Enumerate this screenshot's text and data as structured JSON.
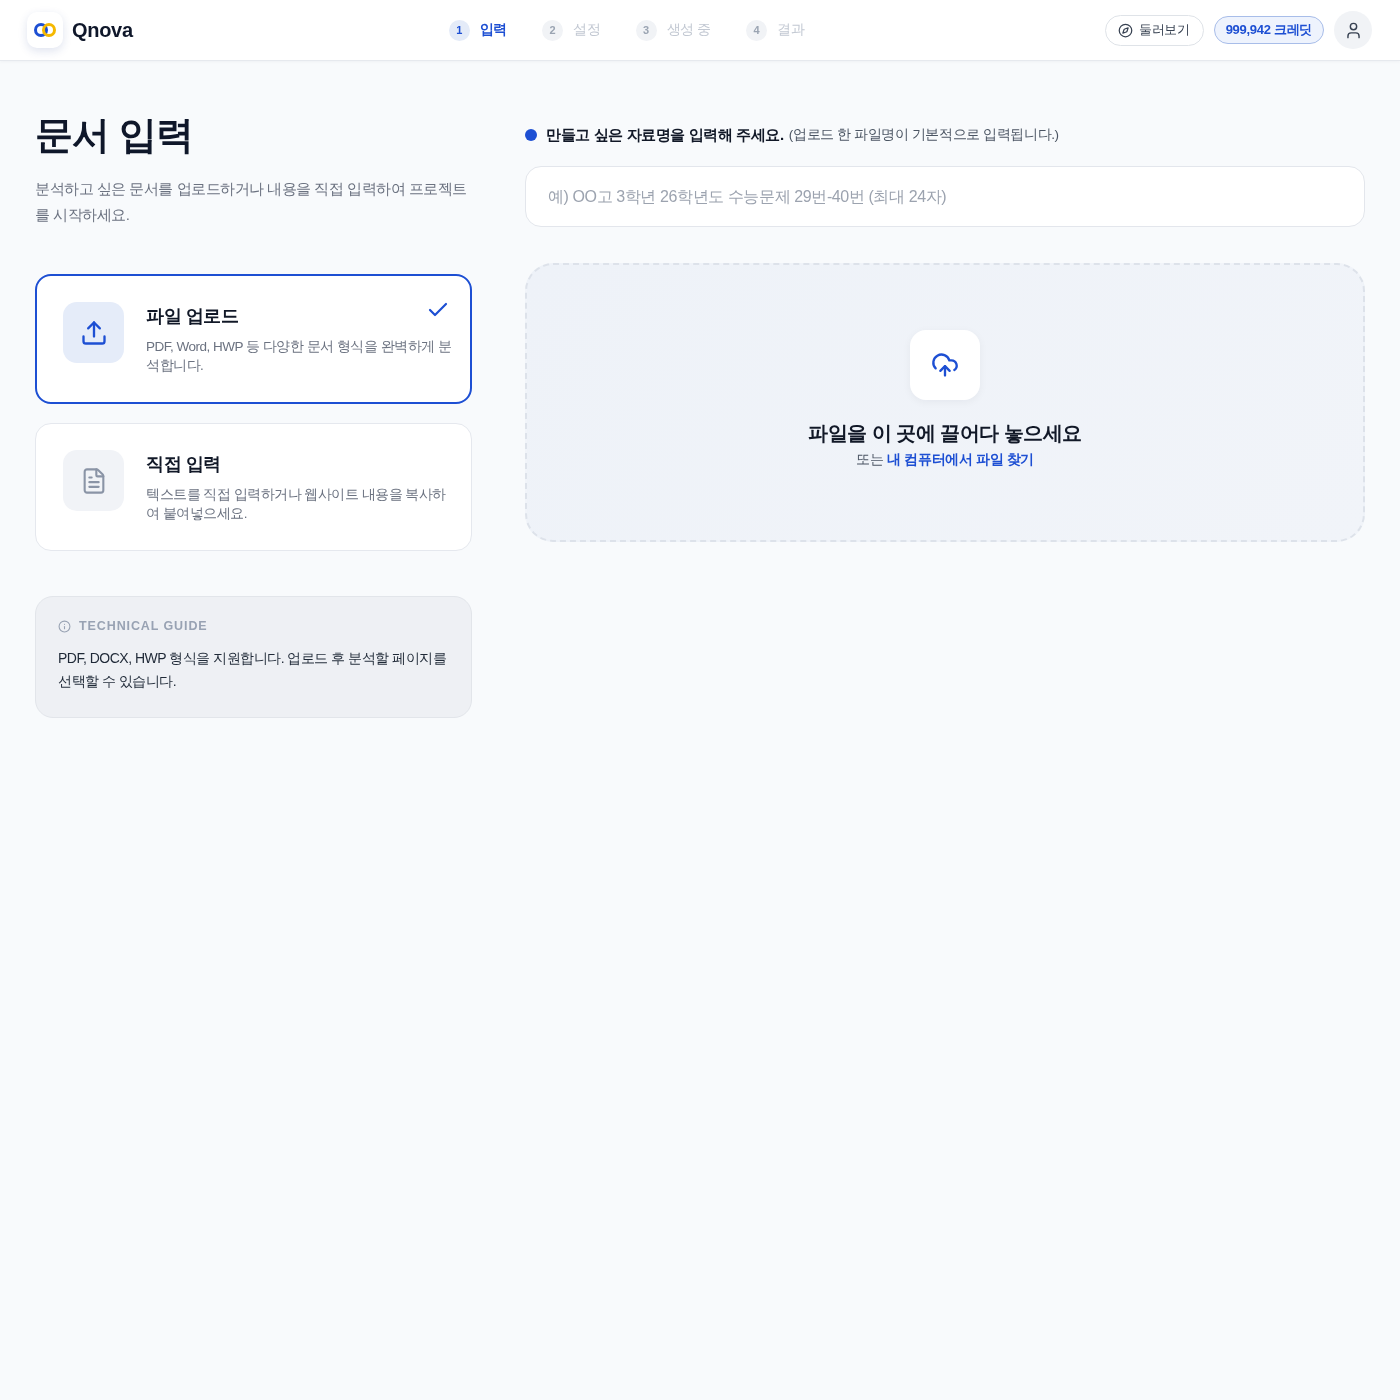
{
  "header": {
    "logo": "Qnova",
    "steps": [
      {
        "number": "1",
        "label": "입력",
        "selected": true
      },
      {
        "number": "2",
        "label": "설정",
        "selected": false
      },
      {
        "number": "3",
        "label": "생성 중",
        "selected": false
      },
      {
        "number": "4",
        "label": "결과",
        "selected": false
      }
    ],
    "tour_button": "둘러보기",
    "credits": "999,942 크레딧"
  },
  "intro": {
    "title": "문서 입력",
    "description": "분석하고 싶은 문서를 업로드하거나 내용을 직접 입력하여 프로젝트를 시작하세요."
  },
  "modes": [
    {
      "kind": "upload",
      "title": "파일 업로드",
      "description": "PDF, Word, HWP 등 다양한 문서 형식을 완벽하게 분석합니다.",
      "selected": true
    },
    {
      "kind": "text",
      "title": "직접 입력",
      "description": "텍스트를 직접 입력하거나 웹사이트 내용을 복사하여 붙여넣으세요.",
      "selected": false
    }
  ],
  "guide": {
    "heading": "TECHNICAL GUIDE",
    "text": "PDF, DOCX, HWP 형식을 지원합니다. 업로드 후 분석할 페이지를 선택할 수 있습니다."
  },
  "name_field": {
    "label": "만들고 싶은 자료명을 입력해 주세요.",
    "hint": "(업로드 한 파일명이 기본적으로 입력됩니다.)",
    "placeholder": "예) OO고 3학년 26학년도 수능문제 29번-40번 (최대 24자)"
  },
  "dropzone": {
    "title": "파일을 이 곳에 끌어다 놓으세요",
    "prefix": "또는",
    "link": "내 컴퓨터에서 파일 찾기"
  }
}
